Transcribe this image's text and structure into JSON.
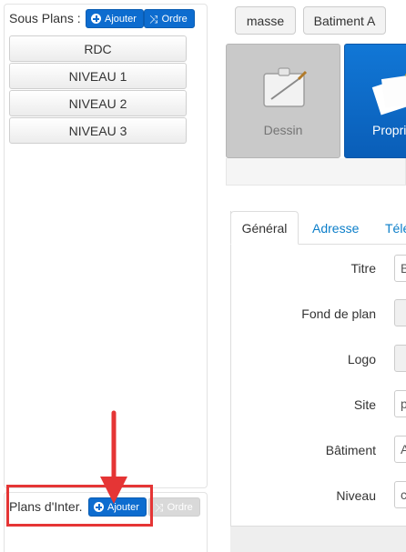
{
  "left": {
    "sous_plans": {
      "title": "Sous Plans :",
      "add_label": "Ajouter",
      "order_label": "Ordre",
      "items": [
        "RDC",
        "NIVEAU 1",
        "NIVEAU 2",
        "NIVEAU 3"
      ]
    },
    "plans_inter": {
      "title": "Plans d'Inter.",
      "add_label": "Ajouter",
      "order_label": "Ordre"
    }
  },
  "toolbar": {
    "masse_label": "masse",
    "batiment_label": "Batiment A"
  },
  "tiles": {
    "dessin_label": "Dessin",
    "props_label": "Propri"
  },
  "tabs": [
    "Général",
    "Adresse",
    "Télé"
  ],
  "form": {
    "fields": [
      {
        "label": "Titre",
        "value": "B"
      },
      {
        "label": "Fond de plan",
        "value": ""
      },
      {
        "label": "Logo",
        "value": ""
      },
      {
        "label": "Site",
        "value": "p"
      },
      {
        "label": "Bâtiment",
        "value": "A"
      },
      {
        "label": "Niveau",
        "value": "c"
      }
    ]
  },
  "colors": {
    "primary": "#0d6ccf",
    "link": "#0b7ec9",
    "annotation": "#e53535"
  }
}
